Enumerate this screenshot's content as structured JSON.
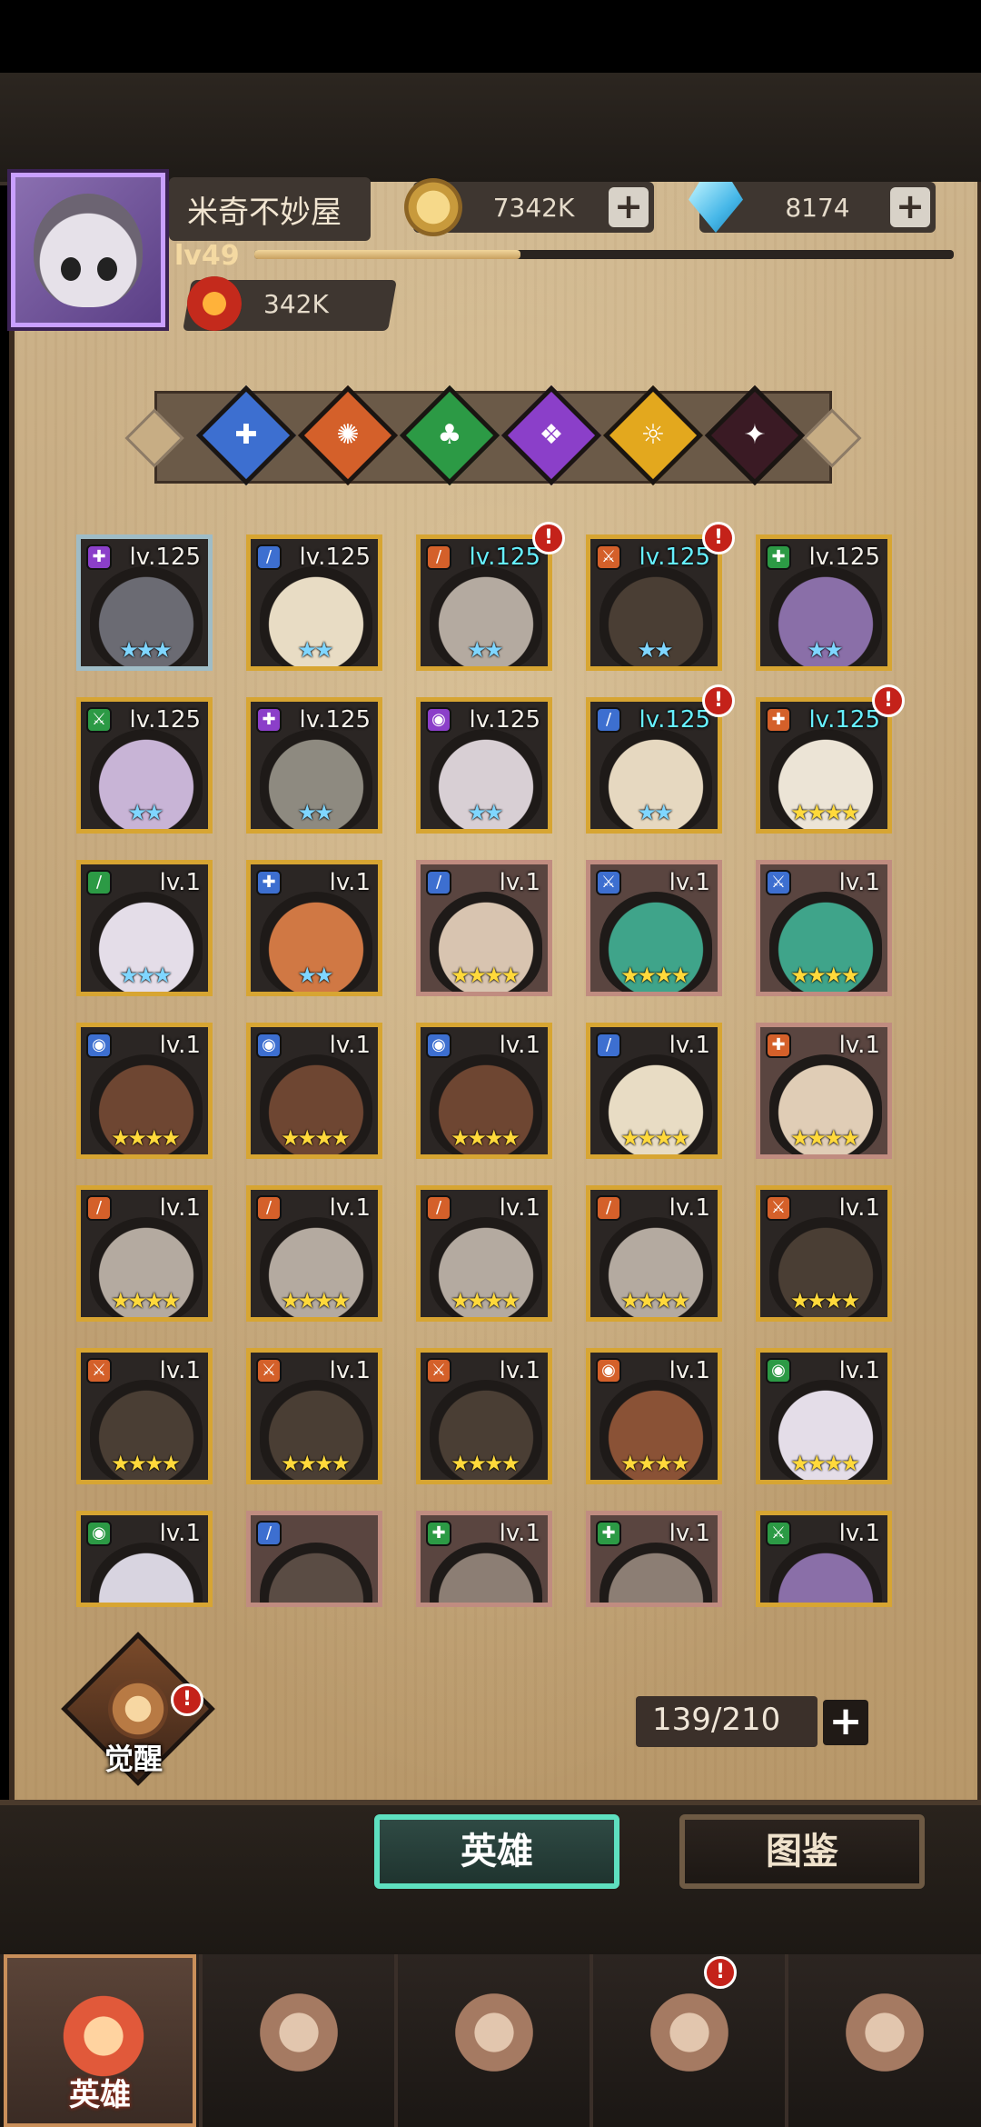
{
  "player": {
    "name": "米奇不妙屋",
    "level": "lv49",
    "xp_fraction": 0.38,
    "power": "342K"
  },
  "resources": {
    "gold": "7342K",
    "diamonds": "8174"
  },
  "filters": [
    {
      "name": "filter-blue",
      "color": "#3d6fd0",
      "glyph": "✚"
    },
    {
      "name": "filter-orange",
      "color": "#d4602a",
      "glyph": "✺"
    },
    {
      "name": "filter-green",
      "color": "#2c9a45",
      "glyph": "♣"
    },
    {
      "name": "filter-purple",
      "color": "#8b3fc9",
      "glyph": "❖"
    },
    {
      "name": "filter-yellow",
      "color": "#e3a81e",
      "glyph": "☼"
    },
    {
      "name": "filter-dark",
      "color": "#3a1a24",
      "glyph": "✦"
    }
  ],
  "heroes": [
    {
      "lv": "lv.125",
      "max": false,
      "stars": "★★★",
      "star_color": "blue",
      "frame": "silver",
      "badge_color": "#8b3fc9",
      "badge": "✚",
      "alert": false,
      "skin": "#6b6b73"
    },
    {
      "lv": "lv.125",
      "max": false,
      "stars": "★★",
      "star_color": "blue",
      "frame": "gold",
      "badge_color": "#3d6fd0",
      "badge": "/",
      "alert": false,
      "skin": "#e8dcc4"
    },
    {
      "lv": "lv.125",
      "max": true,
      "stars": "★★",
      "star_color": "blue",
      "frame": "gold",
      "badge_color": "#d4602a",
      "badge": "/",
      "alert": true,
      "skin": "#b4aaa0"
    },
    {
      "lv": "lv.125",
      "max": true,
      "stars": "★★",
      "star_color": "blue",
      "frame": "gold",
      "badge_color": "#d4602a",
      "badge": "⚔",
      "alert": true,
      "skin": "#4a3e34"
    },
    {
      "lv": "lv.125",
      "max": false,
      "stars": "★★",
      "star_color": "blue",
      "frame": "gold",
      "badge_color": "#2c9a45",
      "badge": "✚",
      "alert": false,
      "skin": "#8a6fa8"
    },
    {
      "lv": "lv.125",
      "max": false,
      "stars": "★★",
      "star_color": "blue",
      "frame": "gold",
      "badge_color": "#2c9a45",
      "badge": "⚔",
      "alert": false,
      "skin": "#c8b4d6"
    },
    {
      "lv": "lv.125",
      "max": false,
      "stars": "★★",
      "star_color": "blue",
      "frame": "gold",
      "badge_color": "#8b3fc9",
      "badge": "✚",
      "alert": false,
      "skin": "#8e8a80"
    },
    {
      "lv": "lv.125",
      "max": false,
      "stars": "★★",
      "star_color": "blue",
      "frame": "gold",
      "badge_color": "#8b3fc9",
      "badge": "◉",
      "alert": false,
      "skin": "#d8cfd4"
    },
    {
      "lv": "lv.125",
      "max": true,
      "stars": "★★",
      "star_color": "blue",
      "frame": "gold",
      "badge_color": "#3d6fd0",
      "badge": "/",
      "alert": true,
      "skin": "#e6d8c0"
    },
    {
      "lv": "lv.125",
      "max": true,
      "stars": "★★★★",
      "star_color": "gold",
      "frame": "gold",
      "badge_color": "#d4602a",
      "badge": "✚",
      "alert": true,
      "skin": "#ece4d6"
    },
    {
      "lv": "lv.1",
      "max": false,
      "stars": "★★★",
      "star_color": "blue",
      "frame": "gold",
      "badge_color": "#2c9a45",
      "badge": "/",
      "alert": false,
      "skin": "#e4dde8"
    },
    {
      "lv": "lv.1",
      "max": false,
      "stars": "★★",
      "star_color": "blue",
      "frame": "gold",
      "badge_color": "#3d6fd0",
      "badge": "✚",
      "alert": false,
      "skin": "#d07844"
    },
    {
      "lv": "lv.1",
      "max": false,
      "stars": "★★★★",
      "star_color": "gold",
      "frame": "bronze",
      "badge_color": "#3d6fd0",
      "badge": "/",
      "alert": false,
      "skin": "#d8c4b0"
    },
    {
      "lv": "lv.1",
      "max": false,
      "stars": "★★★★",
      "star_color": "gold",
      "frame": "bronze",
      "badge_color": "#3d6fd0",
      "badge": "⚔",
      "alert": false,
      "skin": "#3fa48a"
    },
    {
      "lv": "lv.1",
      "max": false,
      "stars": "★★★★",
      "star_color": "gold",
      "frame": "bronze",
      "badge_color": "#3d6fd0",
      "badge": "⚔",
      "alert": false,
      "skin": "#3fa48a"
    },
    {
      "lv": "lv.1",
      "max": false,
      "stars": "★★★★",
      "star_color": "gold",
      "frame": "gold",
      "badge_color": "#3d6fd0",
      "badge": "◉",
      "alert": false,
      "skin": "#6e4632"
    },
    {
      "lv": "lv.1",
      "max": false,
      "stars": "★★★★",
      "star_color": "gold",
      "frame": "gold",
      "badge_color": "#3d6fd0",
      "badge": "◉",
      "alert": false,
      "skin": "#6e4632"
    },
    {
      "lv": "lv.1",
      "max": false,
      "stars": "★★★★",
      "star_color": "gold",
      "frame": "gold",
      "badge_color": "#3d6fd0",
      "badge": "◉",
      "alert": false,
      "skin": "#6e4632"
    },
    {
      "lv": "lv.1",
      "max": false,
      "stars": "★★★★",
      "star_color": "gold",
      "frame": "gold",
      "badge_color": "#3d6fd0",
      "badge": "/",
      "alert": false,
      "skin": "#e8dcc4"
    },
    {
      "lv": "lv.1",
      "max": false,
      "stars": "★★★★",
      "star_color": "gold",
      "frame": "bronze",
      "badge_color": "#d4602a",
      "badge": "✚",
      "alert": false,
      "skin": "#e0cdb6"
    },
    {
      "lv": "lv.1",
      "max": false,
      "stars": "★★★★",
      "star_color": "gold",
      "frame": "gold",
      "badge_color": "#d4602a",
      "badge": "/",
      "alert": false,
      "skin": "#b4aaa0"
    },
    {
      "lv": "lv.1",
      "max": false,
      "stars": "★★★★",
      "star_color": "gold",
      "frame": "gold",
      "badge_color": "#d4602a",
      "badge": "/",
      "alert": false,
      "skin": "#b4aaa0"
    },
    {
      "lv": "lv.1",
      "max": false,
      "stars": "★★★★",
      "star_color": "gold",
      "frame": "gold",
      "badge_color": "#d4602a",
      "badge": "/",
      "alert": false,
      "skin": "#b4aaa0"
    },
    {
      "lv": "lv.1",
      "max": false,
      "stars": "★★★★",
      "star_color": "gold",
      "frame": "gold",
      "badge_color": "#d4602a",
      "badge": "/",
      "alert": false,
      "skin": "#b4aaa0"
    },
    {
      "lv": "lv.1",
      "max": false,
      "stars": "★★★★",
      "star_color": "gold",
      "frame": "gold",
      "badge_color": "#d4602a",
      "badge": "⚔",
      "alert": false,
      "skin": "#4a3e34"
    },
    {
      "lv": "lv.1",
      "max": false,
      "stars": "★★★★",
      "star_color": "gold",
      "frame": "gold",
      "badge_color": "#d4602a",
      "badge": "⚔",
      "alert": false,
      "skin": "#4a3e34"
    },
    {
      "lv": "lv.1",
      "max": false,
      "stars": "★★★★",
      "star_color": "gold",
      "frame": "gold",
      "badge_color": "#d4602a",
      "badge": "⚔",
      "alert": false,
      "skin": "#4a3e34"
    },
    {
      "lv": "lv.1",
      "max": false,
      "stars": "★★★★",
      "star_color": "gold",
      "frame": "gold",
      "badge_color": "#d4602a",
      "badge": "⚔",
      "alert": false,
      "skin": "#4a3e34"
    },
    {
      "lv": "lv.1",
      "max": false,
      "stars": "★★★★",
      "star_color": "gold",
      "frame": "gold",
      "badge_color": "#d4602a",
      "badge": "◉",
      "alert": false,
      "skin": "#8a5236"
    },
    {
      "lv": "lv.1",
      "max": false,
      "stars": "★★★★",
      "star_color": "gold",
      "frame": "gold",
      "badge_color": "#2c9a45",
      "badge": "◉",
      "alert": false,
      "skin": "#e4dde8"
    },
    {
      "lv": "lv.1",
      "max": false,
      "stars": "",
      "star_color": "gold",
      "frame": "gold",
      "badge_color": "#2c9a45",
      "badge": "◉",
      "alert": false,
      "skin": "#d8d4e0"
    },
    {
      "lv": "",
      "max": false,
      "stars": "",
      "star_color": "gold",
      "frame": "bronze",
      "badge_color": "#3d6fd0",
      "badge": "/",
      "alert": false,
      "skin": "#5a4c44"
    },
    {
      "lv": "lv.1",
      "max": false,
      "stars": "",
      "star_color": "gold",
      "frame": "bronze",
      "badge_color": "#2c9a45",
      "badge": "✚",
      "alert": false,
      "skin": "#8c7e74"
    },
    {
      "lv": "lv.1",
      "max": false,
      "stars": "",
      "star_color": "gold",
      "frame": "bronze",
      "badge_color": "#2c9a45",
      "badge": "✚",
      "alert": false,
      "skin": "#8c7e74"
    },
    {
      "lv": "lv.1",
      "max": false,
      "stars": "",
      "star_color": "gold",
      "frame": "gold",
      "badge_color": "#2c9a45",
      "badge": "⚔",
      "alert": false,
      "skin": "#8a6fa8"
    }
  ],
  "awaken": {
    "label": "觉醒",
    "alert": "!"
  },
  "capacity": {
    "text": "139/210"
  },
  "tabs": {
    "heroes": "英雄",
    "album": "图鉴"
  },
  "nav": [
    {
      "name": "nav-heroes",
      "label": "英雄",
      "active": true,
      "alert": false
    },
    {
      "name": "nav-adventure",
      "label": "",
      "active": false,
      "alert": false
    },
    {
      "name": "nav-battle",
      "label": "",
      "active": false,
      "alert": false
    },
    {
      "name": "nav-castle",
      "label": "",
      "active": false,
      "alert": true
    },
    {
      "name": "nav-guild",
      "label": "",
      "active": false,
      "alert": false
    }
  ],
  "alert_glyph": "!",
  "plus_glyph": "+"
}
